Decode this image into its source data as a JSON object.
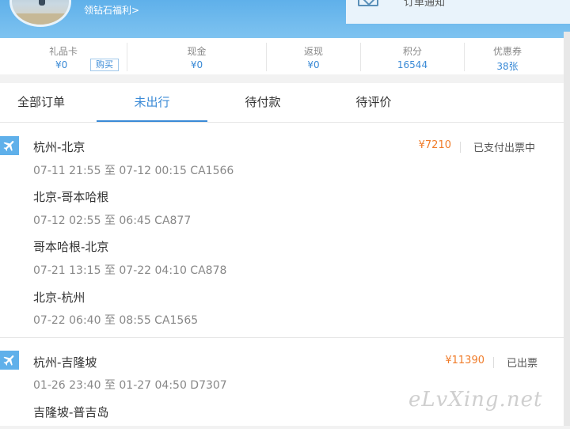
{
  "header": {
    "welfare_link": "领钻石福利>",
    "notice_text": "订单通知"
  },
  "stats": [
    {
      "label": "礼品卡",
      "value": "¥0"
    },
    {
      "label": "现金",
      "value": "¥0"
    },
    {
      "label": "返现",
      "value": "¥0"
    },
    {
      "label": "积分",
      "value": "16544"
    },
    {
      "label": "优惠券",
      "value": "38张"
    }
  ],
  "buy_label": "购买",
  "tabs": [
    {
      "label": "全部订单",
      "active": false
    },
    {
      "label": "未出行",
      "active": true
    },
    {
      "label": "待付款",
      "active": false
    },
    {
      "label": "待评价",
      "active": false
    }
  ],
  "orders": [
    {
      "icon": "plane-icon",
      "price": "¥7210",
      "status": "已支付出票中",
      "segments": [
        {
          "route": "杭州-北京",
          "time": "07-11 21:55 至 07-12 00:15 CA1566"
        },
        {
          "route": "北京-哥本哈根",
          "time": "07-12 02:55 至 06:45 CA877"
        },
        {
          "route": "哥本哈根-北京",
          "time": "07-21 13:15 至 07-22 04:10 CA878"
        },
        {
          "route": "北京-杭州",
          "time": "07-22 06:40 至 08:55 CA1565"
        }
      ]
    },
    {
      "icon": "plane-icon",
      "price": "¥11390",
      "status": "已出票",
      "segments": [
        {
          "route": "杭州-吉隆坡",
          "time": "01-26 23:40 至 01-27 04:50 D7307"
        },
        {
          "route": "吉隆坡-普吉岛",
          "time": ""
        }
      ]
    }
  ],
  "watermark": "eLvXing.net",
  "colors": {
    "accent": "#3a8ad6",
    "header": "#5fb0ea",
    "price": "#f07c2a"
  }
}
